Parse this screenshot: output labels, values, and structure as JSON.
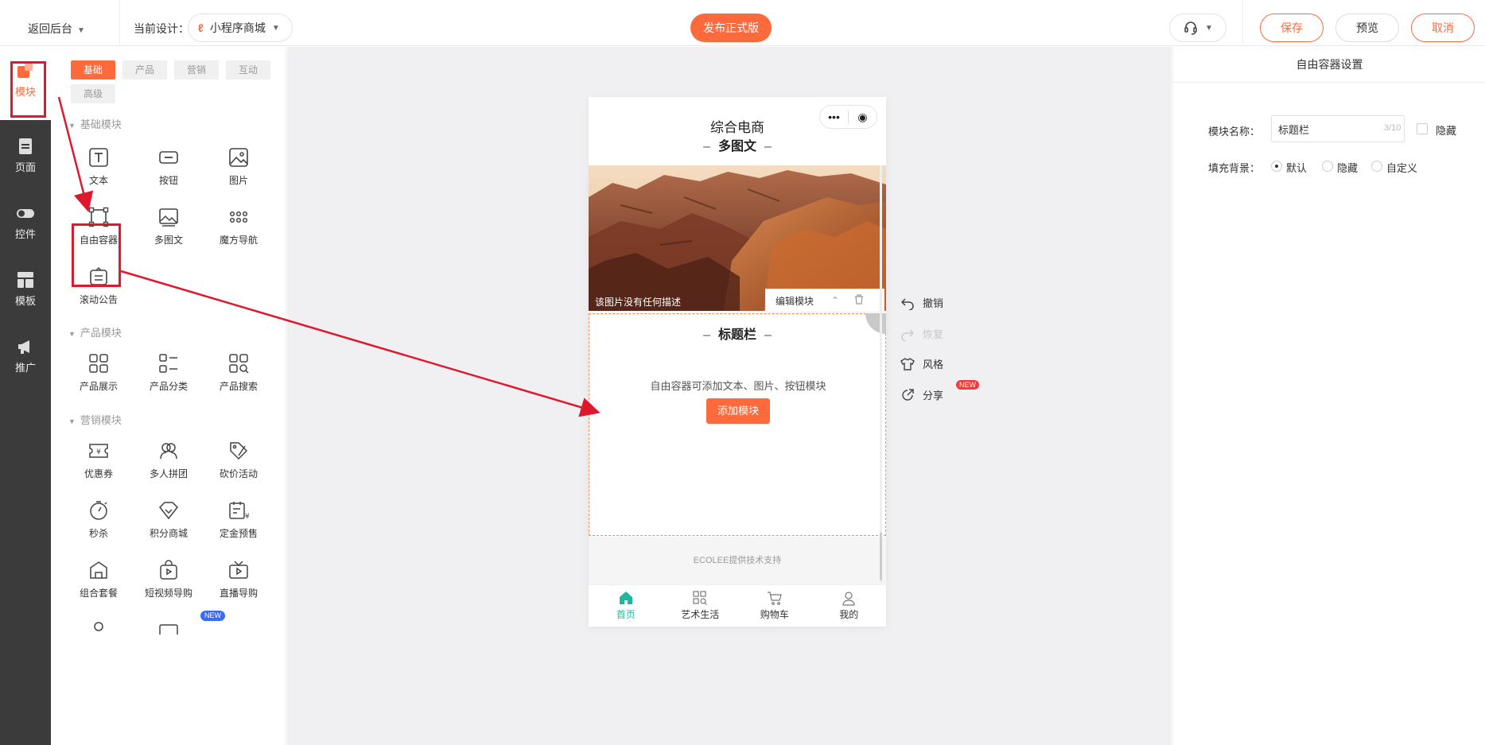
{
  "topbar": {
    "back_label": "返回后台",
    "current_design_label": "当前设计：",
    "design_name": "小程序商城",
    "publish_label": "发布正式版",
    "save_label": "保存",
    "preview_label": "预览",
    "cancel_label": "取消"
  },
  "leftnav": {
    "items": [
      {
        "label": "模块",
        "icon": "module-icon",
        "active": true
      },
      {
        "label": "页面",
        "icon": "page-icon"
      },
      {
        "label": "控件",
        "icon": "toggle-icon"
      },
      {
        "label": "模板",
        "icon": "template-icon"
      },
      {
        "label": "推广",
        "icon": "megaphone-icon"
      }
    ]
  },
  "palette": {
    "tabs": [
      "基础",
      "产品",
      "营销",
      "互动",
      "高级"
    ],
    "active_tab": "基础",
    "sections": {
      "basic": {
        "title": "基础模块",
        "items": [
          "文本",
          "按钮",
          "图片",
          "自由容器",
          "多图文",
          "魔方导航",
          "滚动公告"
        ]
      },
      "product": {
        "title": "产品模块",
        "items": [
          "产品展示",
          "产品分类",
          "产品搜索"
        ]
      },
      "marketing": {
        "title": "营销模块",
        "items": [
          "优惠券",
          "多人拼团",
          "砍价活动",
          "秒杀",
          "积分商城",
          "定金预售",
          "组合套餐",
          "短视频导购",
          "直播导购"
        ]
      }
    },
    "new_badge": "NEW"
  },
  "phone": {
    "title": "综合电商",
    "multi_image_title": "多图文",
    "image_caption": "该图片没有任何描述",
    "edit_module_label": "编辑模块",
    "title_bar_title": "标题栏",
    "free_container_hint": "自由容器可添加文本、图片、按钮模块",
    "add_module_label": "添加模块",
    "tech_support": "ECOLEE提供技术支持",
    "tabbar": [
      {
        "label": "首页",
        "icon": "home-icon",
        "active": true
      },
      {
        "label": "艺术生活",
        "icon": "grid-search-icon"
      },
      {
        "label": "购物车",
        "icon": "cart-icon"
      },
      {
        "label": "我的",
        "icon": "user-icon"
      }
    ]
  },
  "side_actions": {
    "undo": "撤销",
    "redo": "恢复",
    "style": "风格",
    "share": "分享",
    "share_badge": "NEW"
  },
  "settings": {
    "header": "自由容器设置",
    "module_name_label": "模块名称：",
    "module_name_value": "标题栏",
    "module_name_count": "3/10",
    "hide_label": "隐藏",
    "fill_bg_label": "填充背景：",
    "fill_options": [
      "默认",
      "隐藏",
      "自定义"
    ],
    "fill_selected": "默认"
  },
  "colors": {
    "accent": "#ff6a3d",
    "nav_dark": "#3b3b3b",
    "annotation_red": "#e0182d",
    "tab_active_green": "#1fb89a"
  }
}
